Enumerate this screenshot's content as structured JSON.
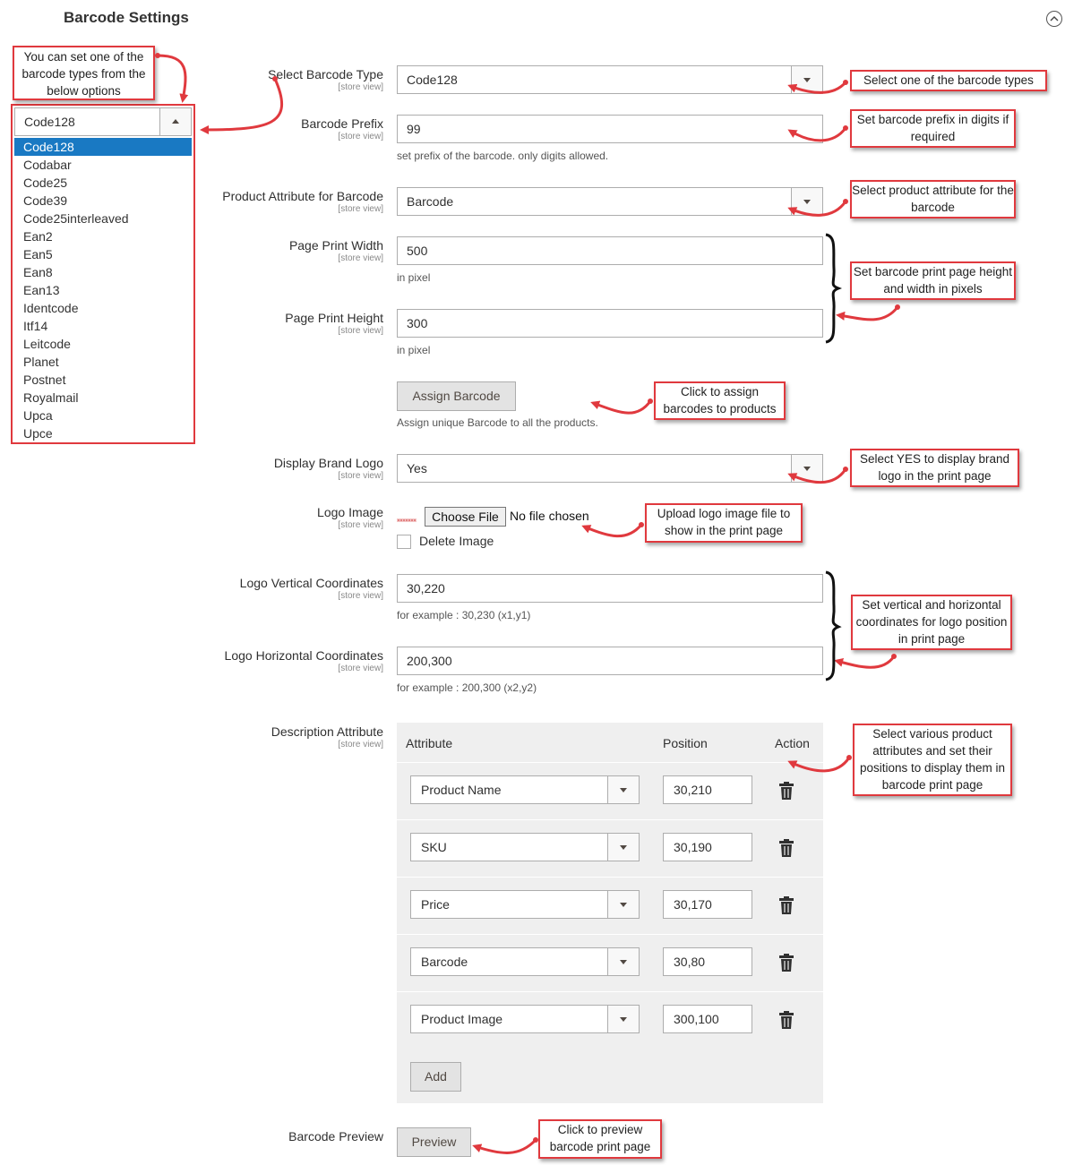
{
  "section": {
    "title": "Barcode Settings"
  },
  "scope_label": "[store view]",
  "dropdown": {
    "current": "Code128",
    "options": [
      "Code128",
      "Codabar",
      "Code25",
      "Code39",
      "Code25interleaved",
      "Ean2",
      "Ean5",
      "Ean8",
      "Ean13",
      "Identcode",
      "Itf14",
      "Leitcode",
      "Planet",
      "Postnet",
      "Royalmail",
      "Upca",
      "Upce"
    ]
  },
  "fields": {
    "barcode_type": {
      "label": "Select Barcode Type",
      "value": "Code128"
    },
    "barcode_prefix": {
      "label": "Barcode Prefix",
      "value": "99",
      "note": "set prefix of the barcode. only digits allowed."
    },
    "product_attribute": {
      "label": "Product Attribute for Barcode",
      "value": "Barcode"
    },
    "page_width": {
      "label": "Page Print Width",
      "value": "500",
      "note": "in pixel"
    },
    "page_height": {
      "label": "Page Print Height",
      "value": "300",
      "note": "in pixel"
    },
    "assign": {
      "button": "Assign Barcode",
      "note": "Assign unique Barcode to all the products."
    },
    "brand_logo": {
      "label": "Display Brand Logo",
      "value": "Yes"
    },
    "logo_image": {
      "label": "Logo Image",
      "choose_button": "Choose File",
      "file_status": "No file chosen",
      "delete_label": "Delete Image"
    },
    "logo_vertical": {
      "label": "Logo Vertical Coordinates",
      "value": "30,220",
      "note": "for example : 30,230 (x1,y1)"
    },
    "logo_horizontal": {
      "label": "Logo Horizontal Coordinates",
      "value": "200,300",
      "note": "for example : 200,300 (x2,y2)"
    },
    "description": {
      "label": "Description Attribute"
    },
    "preview": {
      "label": "Barcode Preview",
      "button": "Preview"
    }
  },
  "table": {
    "headers": {
      "attribute": "Attribute",
      "position": "Position",
      "action": "Action"
    },
    "rows": [
      {
        "attribute": "Product Name",
        "position": "30,210"
      },
      {
        "attribute": "SKU",
        "position": "30,190"
      },
      {
        "attribute": "Price",
        "position": "30,170"
      },
      {
        "attribute": "Barcode",
        "position": "30,80"
      },
      {
        "attribute": "Product Image",
        "position": "300,100"
      }
    ],
    "add_button": "Add"
  },
  "callouts": {
    "dropdown_info": "You can set one of the barcode types from the below options",
    "barcode_type": "Select one of the barcode types",
    "prefix": "Set barcode prefix in digits if required",
    "attribute": "Select product attribute for the barcode",
    "page_size": "Set barcode print page height and width in pixels",
    "assign": "Click to assign barcodes to products",
    "brand_logo": "Select YES to display brand logo in the print page",
    "logo_upload": "Upload logo image file to show in the print page",
    "coordinates": "Set vertical and horizontal coordinates for logo position in print page",
    "description": "Select various product attributes and set their positions to display them in barcode print page",
    "preview": "Click to preview barcode print page"
  },
  "colors": {
    "callout_border": "#e0393e",
    "selected_option": "#1979c3",
    "table_bg": "#efefef"
  },
  "icons": {
    "collapse": "chevron-up-circle-icon",
    "delete": "trash-icon",
    "logo_thumb": "logo-thumbnail-icon"
  }
}
